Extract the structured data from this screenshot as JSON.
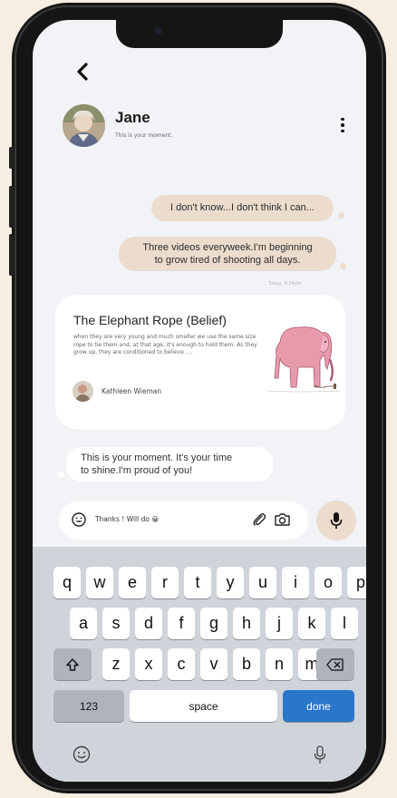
{
  "header": {
    "contact_name": "Jane",
    "contact_status": "This is your moment."
  },
  "messages": {
    "out1": "I don't know...I don't think I can...",
    "out2_line1": "Three videos everyweek.I'm beginning",
    "out2_line2": "to grow tired of shooting all days.",
    "timestamp": "Today, 8.34am",
    "card": {
      "title": "The Elephant Rope (Belief)",
      "body": "when they are very young and much smaller we use the same size rope to tie them and, at that age, it's enough to hold them. As they grow up, they are conditioned to believe ....",
      "author": "Kathleen Wieman"
    },
    "in1_line1": "This is your moment. It's your time",
    "in1_line2": "to shine.I'm proud of you!"
  },
  "composer": {
    "value": "Thanks ! Will do 😀"
  },
  "keyboard": {
    "row1": [
      "q",
      "w",
      "e",
      "r",
      "t",
      "y",
      "u",
      "i",
      "o",
      "p"
    ],
    "row2": [
      "a",
      "s",
      "d",
      "f",
      "g",
      "h",
      "j",
      "k",
      "l"
    ],
    "row3": [
      "z",
      "x",
      "c",
      "v",
      "b",
      "n",
      "m"
    ],
    "numbers_label": "123",
    "space_label": "space",
    "done_label": "done"
  },
  "colors": {
    "background": "#f7ede0",
    "outgoing_bubble": "#ecdccd",
    "done_key": "#2a76c9",
    "elephant": "#e89aad"
  },
  "icons": {
    "back": "chevron-left-icon",
    "menu": "more-vertical-icon",
    "emoji": "smile-icon",
    "attach": "paperclip-icon",
    "camera": "camera-icon",
    "mic": "microphone-icon",
    "shift": "shift-icon",
    "delete": "backspace-icon"
  }
}
